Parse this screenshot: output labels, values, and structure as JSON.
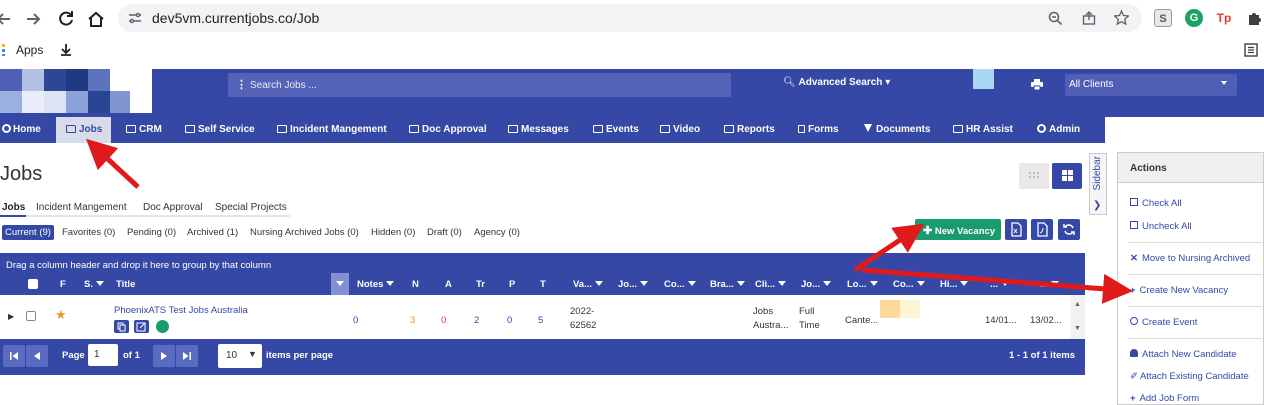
{
  "browser": {
    "url": "dev5vm.currentjobs.co/Job",
    "bookmark_apps": "Apps",
    "ext_s": "S",
    "ext_g": "G",
    "ext_tp": "Tp"
  },
  "header": {
    "search_placeholder": "Search Jobs ...",
    "advanced_search": "Advanced Search",
    "clients_select": "All Clients"
  },
  "nav": [
    {
      "label": "Home",
      "icon": "gear-icon"
    },
    {
      "label": "Jobs",
      "icon": "folder-icon"
    },
    {
      "label": "CRM",
      "icon": "crm-icon"
    },
    {
      "label": "Self Service",
      "icon": "grid-icon"
    },
    {
      "label": "Incident Mangement",
      "icon": "grid-icon"
    },
    {
      "label": "Doc Approval",
      "icon": "grid-icon"
    },
    {
      "label": "Messages",
      "icon": "envelope-icon"
    },
    {
      "label": "Events",
      "icon": "calendar-icon"
    },
    {
      "label": "Video",
      "icon": "video-icon"
    },
    {
      "label": "Reports",
      "icon": "report-icon"
    },
    {
      "label": "Forms",
      "icon": "file-icon"
    },
    {
      "label": "Documents",
      "icon": "filter-icon"
    },
    {
      "label": "HR Assist",
      "icon": "grid-icon"
    },
    {
      "label": "Admin",
      "icon": "gear-icon"
    }
  ],
  "page": {
    "title": "Jobs",
    "tabs": [
      "Jobs",
      "Incident Mangement",
      "Doc Approval",
      "Special Projects"
    ],
    "filters": [
      "Current (9)",
      "Favorites (0)",
      "Pending (0)",
      "Archived (1)",
      "Nursing Archived Jobs (0)",
      "Hidden (0)",
      "Draft (0)",
      "Agency (0)"
    ],
    "new_vacancy": "New Vacancy"
  },
  "grid": {
    "group_hint": "Drag a column header and drop it here to group by that column",
    "columns": [
      "F",
      "S.",
      "Title",
      "Notes",
      "N",
      "A",
      "Tr",
      "P",
      "T",
      "Va...",
      "Jo...",
      "Co...",
      "Bra...",
      "Cli...",
      "Jo...",
      "Lo...",
      "Co...",
      "Hi...",
      "...",
      "..."
    ],
    "row": {
      "title": "PhoenixATS Test Jobs Australia",
      "notes": "0",
      "n": "3",
      "a": "0",
      "tr": "2",
      "p": "0",
      "t": "5",
      "vacancy_1": "2022-",
      "vacancy_2": "62562",
      "client_1": "Jobs",
      "client_2": "Austra...",
      "jobtype_1": "Full",
      "jobtype_2": "Time",
      "location": "Cante...",
      "date1": "14/01...",
      "date2": "13/02..."
    },
    "pager": {
      "page_label": "Page",
      "page_value": "1",
      "of_label": "of 1",
      "page_size": "10",
      "per_page": "items per page",
      "summary": "1 - 1 of 1 items"
    }
  },
  "sidebar": {
    "tab_label": "Sidebar",
    "header": "Actions",
    "actions": [
      "Check All",
      "Uncheck All",
      "Move to Nursing Archived",
      "Create New Vacancy",
      "Create Event",
      "Attach New Candidate",
      "Attach Existing Candidate",
      "Add Job Form"
    ]
  },
  "colors": {
    "primary": "#3548a6",
    "orange": "#e8962e",
    "red": "#e53935",
    "green": "#1a9b6e",
    "annotation": "#e0191a"
  }
}
